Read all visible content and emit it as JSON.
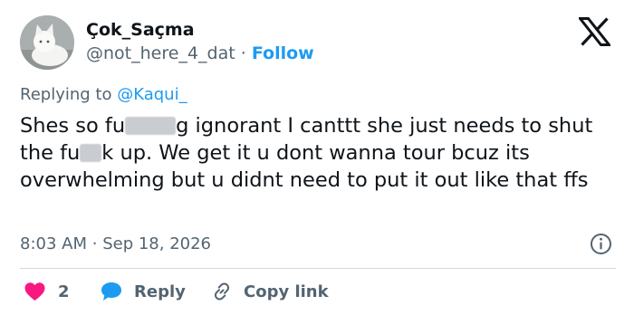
{
  "author": {
    "display_name": "Çok_Saçma",
    "handle": "@not_here_4_dat",
    "separator": "·",
    "follow_label": "Follow",
    "avatar_icon": "white-cat-photo"
  },
  "platform_logo": "x-logo-icon",
  "reply_context": {
    "prefix": "Replying to",
    "mention": "@Kaqui_"
  },
  "tweet": {
    "part1": "Shes so fu",
    "part2": "g ignorant I canttt she just needs to shut the fu",
    "part3": "k up. We get it u dont wanna tour bcuz its overwhelming but u didnt need to put it out like that ffs"
  },
  "meta": {
    "time": "8:03 AM",
    "separator": "·",
    "date": "Sep 18, 2026"
  },
  "actions": {
    "like_count": "2",
    "reply_label": "Reply",
    "copy_label": "Copy link"
  },
  "colors": {
    "like": "#f91880",
    "reply": "#1d9bf0",
    "link": "#1d9bf0",
    "secondary_text": "#536471"
  }
}
